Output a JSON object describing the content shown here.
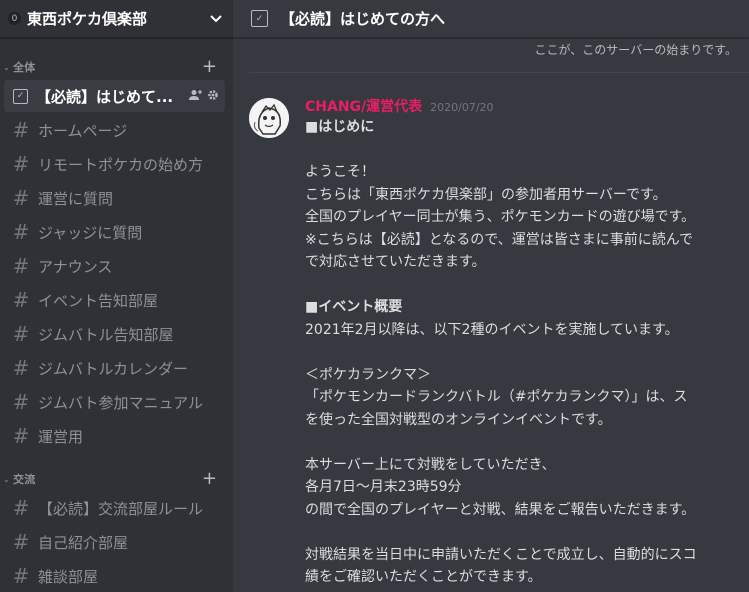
{
  "server": {
    "badge": "0",
    "name": "東西ポケカ倶楽部"
  },
  "topbar": {
    "title": "【必読】はじめての方へ"
  },
  "categories": [
    {
      "name": "全体",
      "channels": [
        {
          "name": "【必読】はじめて...",
          "type": "rules",
          "active": true
        },
        {
          "name": "ホームページ"
        },
        {
          "name": "リモートポケカの始め方"
        },
        {
          "name": "運営に質問"
        },
        {
          "name": "ジャッジに質問"
        },
        {
          "name": "アナウンス"
        },
        {
          "name": "イベント告知部屋"
        },
        {
          "name": "ジムバトル告知部屋"
        },
        {
          "name": "ジムバトルカレンダー"
        },
        {
          "name": "ジムバト参加マニュアル"
        },
        {
          "name": "運営用"
        }
      ]
    },
    {
      "name": "交流",
      "channels": [
        {
          "name": "【必読】交流部屋ルール"
        },
        {
          "name": "自己紹介部屋"
        },
        {
          "name": "雑談部屋"
        }
      ]
    }
  ],
  "main": {
    "start_note": "ここが、このサーバーの始まりです。",
    "message": {
      "author": "CHANG/運営代表",
      "timestamp": "2020/07/20",
      "author_color": "#e91e63",
      "lines": [
        {
          "text": "■はじめに",
          "bold": true
        },
        {
          "text": ""
        },
        {
          "text": "ようこそ！"
        },
        {
          "text": "こちらは「東西ポケカ倶楽部」の参加者用サーバーです。"
        },
        {
          "text": "全国のプレイヤー同士が集う、ポケモンカードの遊び場です。"
        },
        {
          "text": "※こちらは【必読】となるので、運営は皆さまに事前に読んで"
        },
        {
          "text": "で対応させていただきます。"
        },
        {
          "text": ""
        },
        {
          "text": "■イベント概要",
          "bold": true
        },
        {
          "text": "2021年2月以降は、以下2種のイベントを実施しています。"
        },
        {
          "text": ""
        },
        {
          "text": "＜ポケカランクマ＞"
        },
        {
          "text": "「ポケモンカードランクバトル（#ポケカランクマ）」は、ス"
        },
        {
          "text": "を使った全国対戦型のオンラインイベントです。"
        },
        {
          "text": ""
        },
        {
          "text": "本サーバー上にて対戦をしていただき、"
        },
        {
          "text": "各月7日〜月末23時59分"
        },
        {
          "text": "の間で全国のプレイヤーと対戦、結果をご報告いただきます。"
        },
        {
          "text": ""
        },
        {
          "text": "対戦結果を当日中に申請いただくことで成立し、自動的にスコ"
        },
        {
          "text": "績をご確認いただくことができます。"
        }
      ]
    }
  },
  "colors": {
    "sidebar_bg": "#2f3136",
    "main_bg": "#36393f",
    "active_channel_bg": "#393c43",
    "author": "#e91e63"
  }
}
